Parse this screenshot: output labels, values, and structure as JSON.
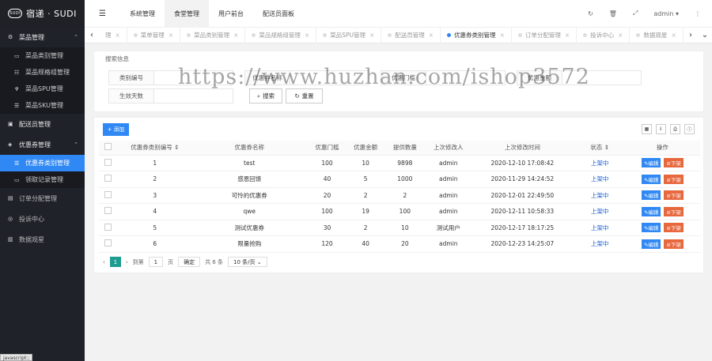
{
  "app": {
    "logo_badge": "SUDI",
    "logo_text": "宿递 · SUDI"
  },
  "sidebar": {
    "groups": [
      {
        "label": "菜品管理",
        "icon": "gear-icon",
        "expanded": true,
        "items": [
          {
            "label": "菜品类别管理",
            "icon": "category-icon"
          },
          {
            "label": "菜品规格组管理",
            "icon": "sitemap-icon"
          },
          {
            "label": "菜品SPU管理",
            "icon": "utensils-icon"
          },
          {
            "label": "菜品SKU管理",
            "icon": "list-icon"
          }
        ]
      },
      {
        "label": "配送员管理",
        "icon": "briefcase-icon",
        "expanded": false,
        "items": []
      },
      {
        "label": "优惠券管理",
        "icon": "tag-icon",
        "expanded": true,
        "items": [
          {
            "label": "优惠券类别管理",
            "icon": "list-icon",
            "active": true
          },
          {
            "label": "领取记录管理",
            "icon": "card-icon"
          }
        ]
      },
      {
        "label": "订单分配管理",
        "icon": "doc-icon",
        "expanded": false,
        "items": []
      },
      {
        "label": "投诉中心",
        "icon": "target-icon",
        "expanded": false,
        "items": []
      },
      {
        "label": "数据观星",
        "icon": "chart-icon",
        "expanded": false,
        "items": []
      }
    ]
  },
  "header": {
    "nav": [
      "系统管理",
      "食堂管理",
      "用户前台",
      "配送员面板"
    ],
    "active_nav": 1,
    "user": "admin"
  },
  "tabs": {
    "items": [
      "理",
      "菜单管理",
      "菜品类别管理",
      "菜品规格组管理",
      "菜品SPU管理",
      "配送员管理",
      "优惠券类别管理",
      "订单分配管理",
      "投诉中心",
      "数据观星"
    ],
    "active": 6
  },
  "watermark": "https://www.huzhan.com/ishop3572",
  "search": {
    "title": "搜索信息",
    "fields": [
      {
        "label": "类别编号",
        "value": ""
      },
      {
        "label": "优惠券名称",
        "value": ""
      },
      {
        "label": "优惠门槛",
        "value": ""
      },
      {
        "label": "优惠金额",
        "value": ""
      },
      {
        "label": "生效天数",
        "value": ""
      }
    ],
    "search_btn": "搜索",
    "reset_btn": "重置"
  },
  "table": {
    "add_btn": "添加",
    "columns": [
      "优惠券类别编号",
      "优惠券名称",
      "优惠门槛",
      "优惠金额",
      "提供数量",
      "上次修改人",
      "上次修改时间",
      "状态",
      "操作"
    ],
    "rows": [
      {
        "id": "1",
        "name": "test",
        "threshold": "100",
        "amount": "10",
        "qty": "9898",
        "editor": "admin",
        "time": "2020-12-10 17:08:42",
        "status": "上架中"
      },
      {
        "id": "2",
        "name": "感恩回馈",
        "threshold": "40",
        "amount": "5",
        "qty": "1000",
        "editor": "admin",
        "time": "2020-11-29 14:24:52",
        "status": "上架中"
      },
      {
        "id": "3",
        "name": "可怜的优惠券",
        "threshold": "20",
        "amount": "2",
        "qty": "2",
        "editor": "admin",
        "time": "2020-12-01 22:49:50",
        "status": "上架中"
      },
      {
        "id": "4",
        "name": "qwe",
        "threshold": "100",
        "amount": "19",
        "qty": "100",
        "editor": "admin",
        "time": "2020-12-11 10:58:33",
        "status": "上架中"
      },
      {
        "id": "5",
        "name": "测试优惠券",
        "threshold": "30",
        "amount": "2",
        "qty": "10",
        "editor": "测试用户",
        "time": "2020-12-17 18:17:25",
        "status": "上架中"
      },
      {
        "id": "6",
        "name": "限量抢购",
        "threshold": "120",
        "amount": "40",
        "qty": "20",
        "editor": "admin",
        "time": "2020-12-23 14:25:07",
        "status": "上架中"
      }
    ],
    "edit_label": "编辑",
    "off_label": "下架"
  },
  "pager": {
    "current": "1",
    "goto_label": "到第",
    "goto_value": "1",
    "page_label": "页",
    "confirm": "确定",
    "total": "共 6 条",
    "per_page": "10 条/页"
  },
  "status_bar": "javascript:;"
}
